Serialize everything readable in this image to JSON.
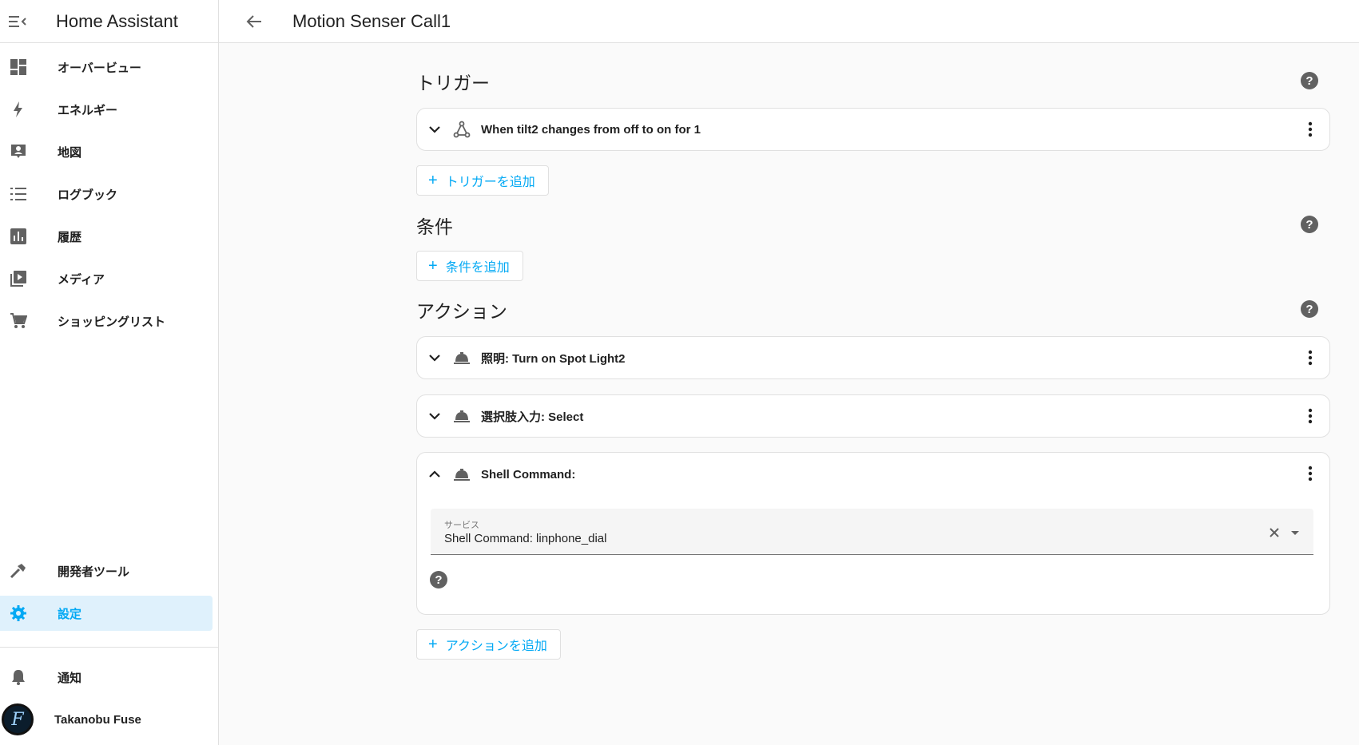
{
  "app": {
    "title": "Home Assistant"
  },
  "sidebar": {
    "items": [
      {
        "label": "オーバービュー",
        "icon": "dashboard-icon"
      },
      {
        "label": "エネルギー",
        "icon": "lightning-icon"
      },
      {
        "label": "地図",
        "icon": "map-account-icon"
      },
      {
        "label": "ログブック",
        "icon": "list-icon"
      },
      {
        "label": "履歴",
        "icon": "chart-box-icon"
      },
      {
        "label": "メディア",
        "icon": "media-play-icon"
      },
      {
        "label": "ショッピングリスト",
        "icon": "cart-icon"
      }
    ],
    "bottom_items": [
      {
        "label": "開発者ツール",
        "icon": "hammer-icon"
      },
      {
        "label": "設定",
        "icon": "gear-icon",
        "active": true
      }
    ],
    "notifications": {
      "label": "通知",
      "icon": "bell-icon"
    },
    "user": {
      "name": "Takanobu Fuse",
      "avatar_letter": "F"
    }
  },
  "header": {
    "title": "Motion Senser Call1"
  },
  "triggers": {
    "title": "トリガー",
    "items": [
      {
        "label": "When tilt2 changes from off to on for 1",
        "icon": "state-change-icon"
      }
    ],
    "add_label": "トリガーを追加"
  },
  "conditions": {
    "title": "条件",
    "add_label": "条件を追加"
  },
  "actions": {
    "title": "アクション",
    "items": [
      {
        "label": "照明: Turn on Spot Light2",
        "icon": "service-bell-icon",
        "expanded": false
      },
      {
        "label": "選択肢入力: Select",
        "icon": "service-bell-icon",
        "expanded": false
      },
      {
        "label": "Shell Command:",
        "icon": "service-bell-icon",
        "expanded": true
      }
    ],
    "service_field": {
      "label": "サービス",
      "value": "Shell Command: linphone_dial"
    },
    "add_label": "アクションを追加"
  },
  "colors": {
    "accent": "#03a9f4",
    "active_bg": "#dff1fc",
    "icon": "#616161"
  }
}
